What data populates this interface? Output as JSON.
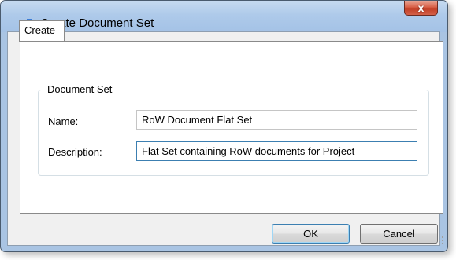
{
  "window": {
    "title": "Create Document Set",
    "app_icon": "app-icon",
    "close_glyph": "x"
  },
  "tabs": [
    {
      "label": "Create",
      "selected": true
    }
  ],
  "group": {
    "label": "Document Set",
    "fields": {
      "name": {
        "label": "Name:",
        "value": "RoW Document Flat Set"
      },
      "description": {
        "label": "Description:",
        "value": "Flat Set containing RoW documents for Project"
      }
    }
  },
  "buttons": {
    "ok": "OK",
    "cancel": "Cancel"
  }
}
